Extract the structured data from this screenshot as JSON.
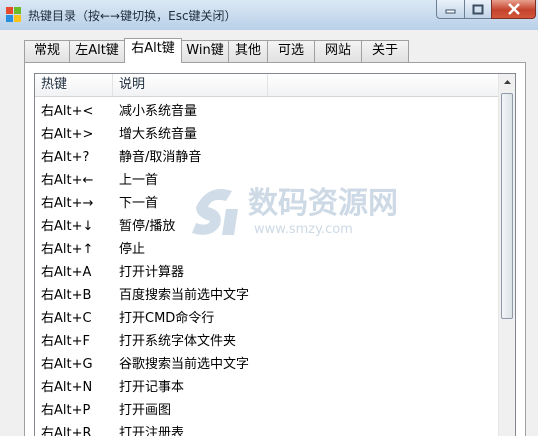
{
  "window": {
    "title": "热键目录（按←→键切换，Esc键关闭）",
    "icon": "windows-app-icon"
  },
  "tabs": [
    {
      "label": "常规",
      "active": false
    },
    {
      "label": "左Alt键",
      "active": false
    },
    {
      "label": "右Alt键",
      "active": true
    },
    {
      "label": "Win键",
      "active": false
    },
    {
      "label": "其他",
      "active": false
    },
    {
      "label": "可选",
      "active": false
    },
    {
      "label": "网站",
      "active": false
    },
    {
      "label": "关于",
      "active": false
    }
  ],
  "list": {
    "headers": [
      "热键",
      "说明"
    ],
    "rows": [
      {
        "key": "右Alt+<",
        "desc": "减小系统音量"
      },
      {
        "key": "右Alt+>",
        "desc": "增大系统音量"
      },
      {
        "key": "右Alt+?",
        "desc": "静音/取消静音"
      },
      {
        "key": "右Alt+←",
        "desc": "上一首"
      },
      {
        "key": "右Alt+→",
        "desc": "下一首"
      },
      {
        "key": "右Alt+↓",
        "desc": "暂停/播放"
      },
      {
        "key": "右Alt+↑",
        "desc": "停止"
      },
      {
        "key": "右Alt+A",
        "desc": "打开计算器"
      },
      {
        "key": "右Alt+B",
        "desc": "百度搜索当前选中文字"
      },
      {
        "key": "右Alt+C",
        "desc": "打开CMD命令行"
      },
      {
        "key": "右Alt+F",
        "desc": "打开系统字体文件夹"
      },
      {
        "key": "右Alt+G",
        "desc": "谷歌搜索当前选中文字"
      },
      {
        "key": "右Alt+N",
        "desc": "打开记事本"
      },
      {
        "key": "右Alt+P",
        "desc": "打开画图"
      },
      {
        "key": "右Alt+R",
        "desc": "打开注册表"
      }
    ]
  },
  "watermark": {
    "text": "数码资源网",
    "url": "www.smzy.com"
  },
  "colors": {
    "title_bar": "#b9d0e8",
    "close_button": "#c4432c",
    "watermark": "#c8d6e4"
  }
}
